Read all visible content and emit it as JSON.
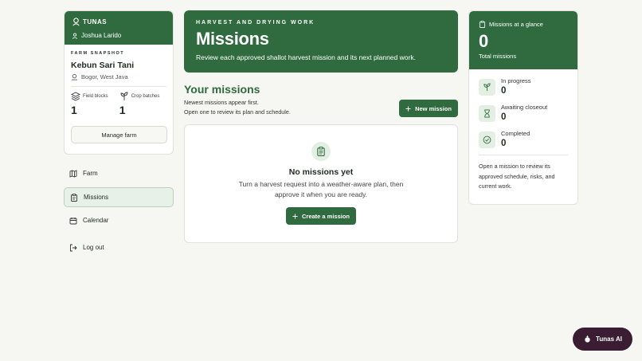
{
  "sidebar": {
    "brand": "TUNAS",
    "user_name": "Joshua Larido",
    "snapshot_label": "FARM SNAPSHOT",
    "farm_name": "Kebun Sari Tani",
    "location": "Bogor, West Java",
    "field_blocks_label": "Field blocks",
    "field_blocks_value": "1",
    "crop_batches_label": "Crop batches",
    "crop_batches_value": "1",
    "manage_label": "Manage farm",
    "nav": [
      {
        "label": "Farm",
        "icon": "map-icon"
      },
      {
        "label": "Missions",
        "icon": "clipboard-icon",
        "active": true
      },
      {
        "label": "Calendar",
        "icon": "calendar-icon"
      },
      {
        "label": "Log out",
        "icon": "logout-icon"
      }
    ]
  },
  "hero": {
    "eyebrow": "HARVEST AND DRYING WORK",
    "title": "Missions",
    "description": "Review each approved shallot harvest mission and its next planned work."
  },
  "missions": {
    "title": "Your missions",
    "subtitle_1": "Newest missions appear first.",
    "subtitle_2": "Open one to review its plan and schedule.",
    "new_button": "New mission",
    "empty_title": "No missions yet",
    "empty_text": "Turn a harvest request into a weather-aware plan, then approve it when you are ready.",
    "create_button": "Create a mission"
  },
  "glance": {
    "title": "Missions at a glance",
    "total_value": "0",
    "total_label": "Total missions",
    "in_progress_label": "In progress",
    "in_progress_value": "0",
    "awaiting_label": "Awaiting closeout",
    "awaiting_value": "0",
    "completed_label": "Completed",
    "completed_value": "0",
    "note": "Open a mission to review its approved schedule, risks, and current work."
  },
  "assistant": {
    "label": "Tunas AI"
  },
  "colors": {
    "primary": "#2f6b3f",
    "accent_soft": "#e4efe3",
    "assistant": "#3a1c33"
  }
}
